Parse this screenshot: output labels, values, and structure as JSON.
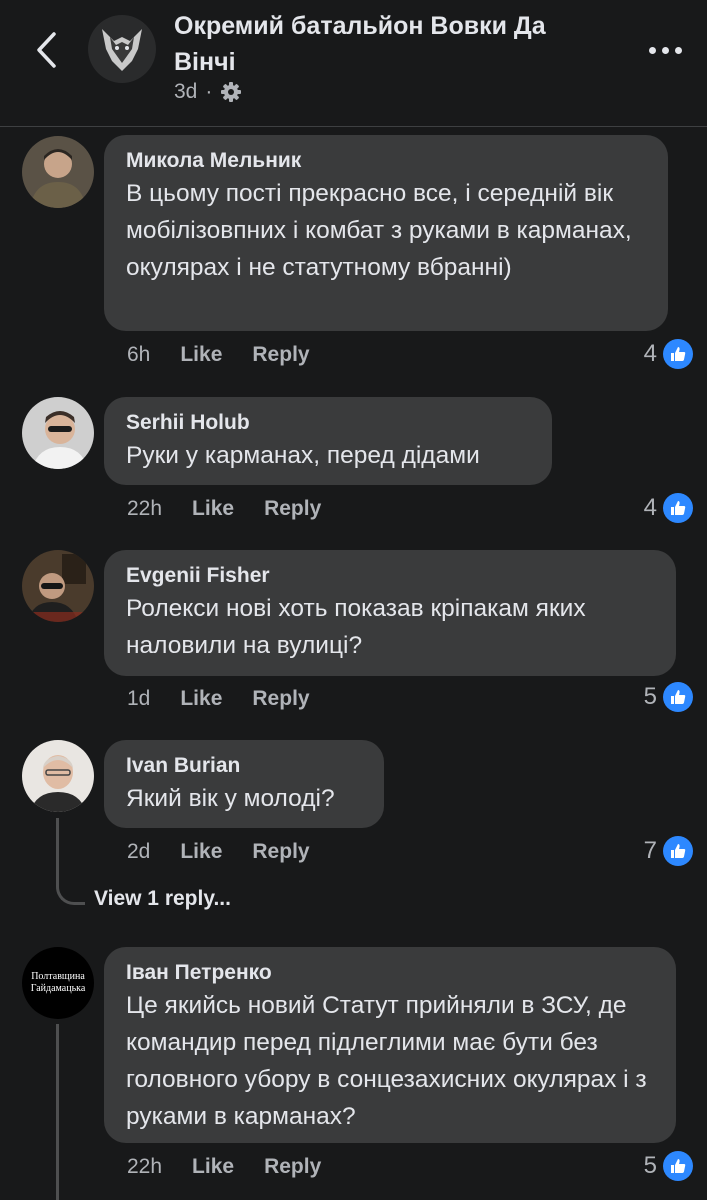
{
  "header": {
    "page_name": "Окремий батальйон Вовки Да Вінчі",
    "time_ago": "3d",
    "dot": "·",
    "privacy_icon": "gear-icon",
    "back_icon": "chevron-left-icon",
    "more_icon": "more-dots-icon"
  },
  "comments": [
    {
      "author": "Микола Мельник",
      "text": "В цьому пості прекрасно все, і середній вік мобілізовпних і комбат з руками в карманах, окулярах і не статутному вбранні)",
      "time": "6h",
      "like_label": "Like",
      "reply_label": "Reply",
      "reactions": "4"
    },
    {
      "author": "Serhii Holub",
      "text": "Руки у карманах, перед дідами",
      "time": "22h",
      "like_label": "Like",
      "reply_label": "Reply",
      "reactions": "4"
    },
    {
      "author": "Evgenii Fisher",
      "text": "Ролекси нові хоть показав кріпакам яких наловили на вулиці?",
      "time": "1d",
      "like_label": "Like",
      "reply_label": "Reply",
      "reactions": "5"
    },
    {
      "author": "Ivan Burian",
      "text": "Який вік у молоді?",
      "time": "2d",
      "like_label": "Like",
      "reply_label": "Reply",
      "reactions": "7",
      "view_replies": "View 1 reply..."
    },
    {
      "author": "Іван Петренко",
      "text": "Це якийсь новий Статут прийняли в ЗСУ, де командир перед підлеглими має бути без головного убору в сонцезахисних окулярах і з руками в карманах?",
      "time": "22h",
      "like_label": "Like",
      "reply_label": "Reply",
      "reactions": "5",
      "avatar_text": [
        "Полтавщина",
        "Гайдамацька"
      ]
    }
  ],
  "colors": {
    "background": "#18191a",
    "bubble": "#3a3b3c",
    "like_blue": "#2d88ff",
    "secondary_text": "#b0b3b8"
  }
}
